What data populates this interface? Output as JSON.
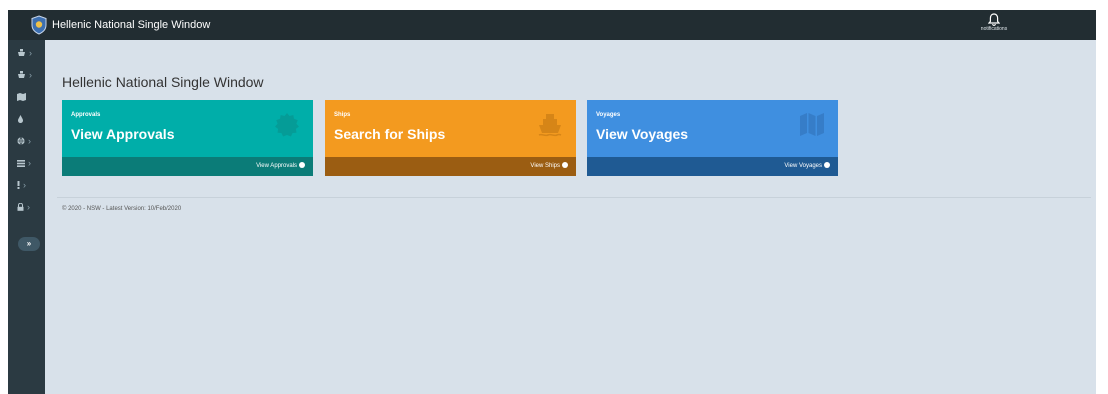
{
  "header": {
    "app_title": "Hellenic National Single Window",
    "notifications_label": "notifications",
    "logo_icon": "shield-logo-icon",
    "bell_icon": "bell-icon"
  },
  "sidebar": {
    "items": [
      {
        "icon": "ship-icon",
        "has_chevron": true
      },
      {
        "icon": "ship-icon",
        "has_chevron": true
      },
      {
        "icon": "map-icon",
        "has_chevron": false
      },
      {
        "icon": "droplet-icon",
        "has_chevron": false
      },
      {
        "icon": "globe-icon",
        "has_chevron": true
      },
      {
        "icon": "list-icon",
        "has_chevron": true
      },
      {
        "icon": "exclamation-icon",
        "has_chevron": true
      },
      {
        "icon": "lock-icon",
        "has_chevron": true
      }
    ],
    "collapse_label": "»",
    "chevron": "›"
  },
  "main": {
    "page_title": "Hellenic National Single Window",
    "cards": [
      {
        "small_label": "Approvals",
        "title": "View Approvals",
        "footer_label": "View Approvals",
        "icon": "badge-icon",
        "color": "#00aea9",
        "footer_color": "#0b7c78"
      },
      {
        "small_label": "Ships",
        "title": "Search for Ships",
        "footer_label": "View Ships",
        "icon": "ship-icon",
        "color": "#f39a1f",
        "footer_color": "#9b5d12"
      },
      {
        "small_label": "Voyages",
        "title": "View Voyages",
        "footer_label": "View Voyages",
        "icon": "map-icon",
        "color": "#3f8fe0",
        "footer_color": "#1f5a93"
      }
    ]
  },
  "footer": {
    "text": "© 2020 - NSW - Latest Version: 10/Feb/2020"
  }
}
